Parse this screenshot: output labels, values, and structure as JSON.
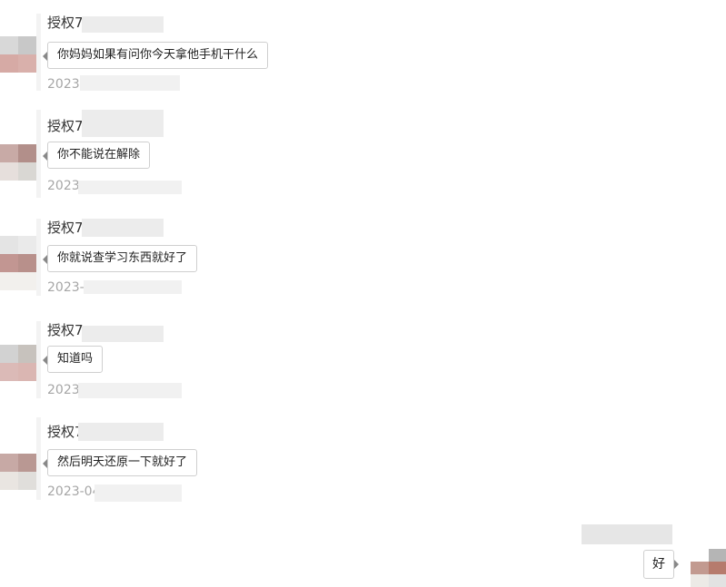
{
  "messages": [
    {
      "sender": "授权7",
      "text": "你妈妈如果有问你今天拿他手机干什么",
      "time": "2023-",
      "avatar_colors": [
        "#d8d8d8",
        "#c8c8c8",
        "#d6aaa5",
        "#d9b0ab"
      ]
    },
    {
      "sender": "授权7",
      "text": "你不能说在解除",
      "time": "2023",
      "avatar_colors": [
        "#c8aaa6",
        "#b28f8a",
        "#e6dfdc",
        "#d9d7d3"
      ]
    },
    {
      "sender": "授权7",
      "text": "你就说查学习东西就好了",
      "time": "2023-",
      "avatar_colors": [
        "#e4e4e4",
        "#eaeaea",
        "#c29692",
        "#b8908b"
      ]
    },
    {
      "sender": "授权7",
      "text": "知道吗",
      "time": "2023",
      "avatar_colors": [
        "#d2d2d2",
        "#c7c2bd",
        "#dbbab7",
        "#dab6b2"
      ]
    },
    {
      "sender": "授权7",
      "text": "然后明天还原一下就好了",
      "time": "2023-04",
      "avatar_colors": [
        "#c7a9a5",
        "#b99893",
        "#e9e5e1",
        "#e0dedb"
      ]
    }
  ],
  "mine": {
    "text": "好",
    "avatar_colors": [
      "#ffffff",
      "#b5b5b5",
      "#c29a90",
      "#b67b6d",
      "#eceae6",
      "#e2e2e2"
    ]
  }
}
